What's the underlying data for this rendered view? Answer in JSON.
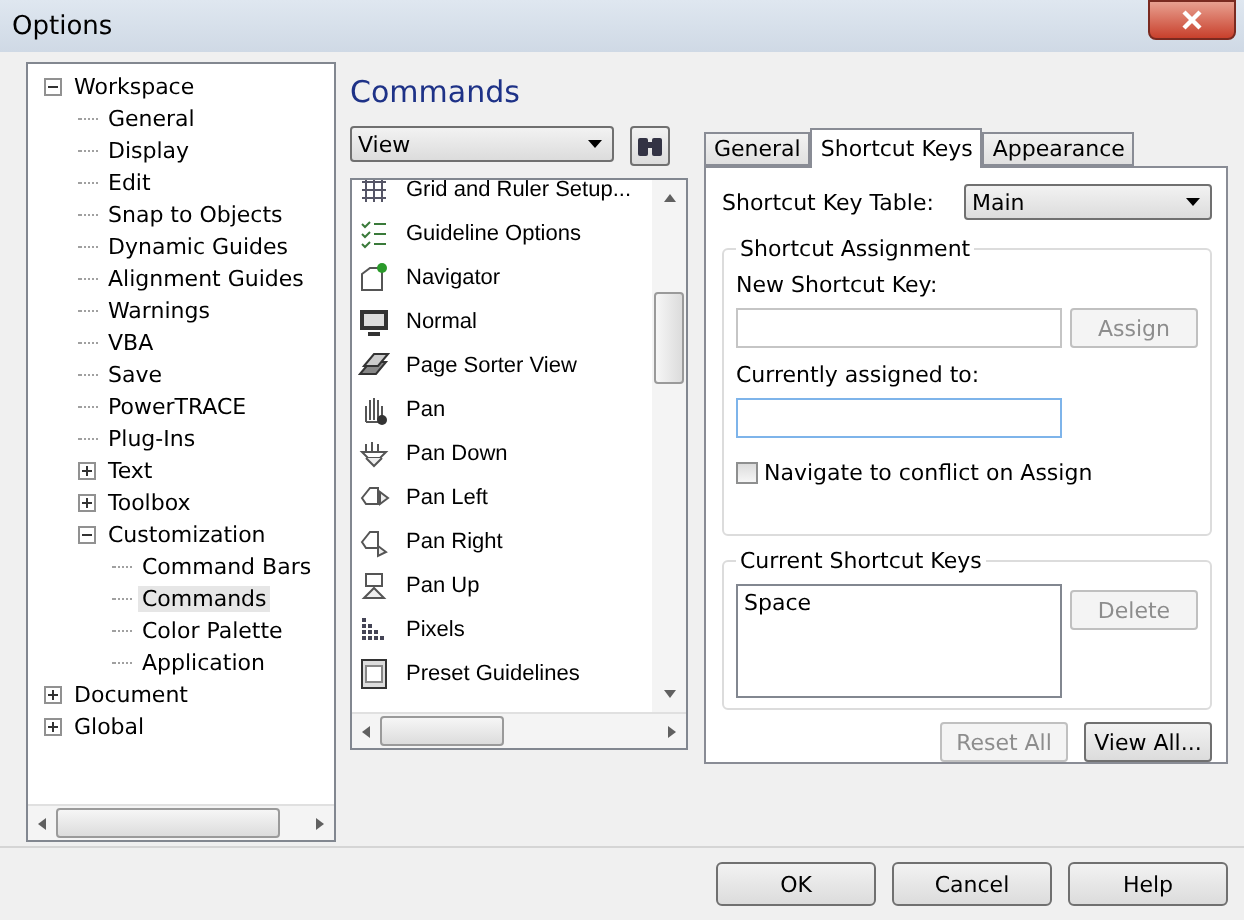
{
  "window": {
    "title": "Options"
  },
  "tree": [
    {
      "label": "Workspace",
      "expanded": true,
      "selected": false,
      "children": [
        {
          "label": "General",
          "selected": false
        },
        {
          "label": "Display",
          "selected": false
        },
        {
          "label": "Edit",
          "selected": false
        },
        {
          "label": "Snap to Objects",
          "selected": false
        },
        {
          "label": "Dynamic Guides",
          "selected": false
        },
        {
          "label": "Alignment Guides",
          "selected": false
        },
        {
          "label": "Warnings",
          "selected": false
        },
        {
          "label": "VBA",
          "selected": false
        },
        {
          "label": "Save",
          "selected": false
        },
        {
          "label": "PowerTRACE",
          "selected": false
        },
        {
          "label": "Plug-Ins",
          "selected": false
        },
        {
          "label": "Text",
          "expanded": false,
          "selected": false
        },
        {
          "label": "Toolbox",
          "expanded": false,
          "selected": false
        },
        {
          "label": "Customization",
          "expanded": true,
          "selected": false,
          "children": [
            {
              "label": "Command Bars",
              "selected": false
            },
            {
              "label": "Commands",
              "selected": true
            },
            {
              "label": "Color Palette",
              "selected": false
            },
            {
              "label": "Application",
              "selected": false
            }
          ]
        }
      ]
    },
    {
      "label": "Document",
      "expanded": false,
      "selected": false
    },
    {
      "label": "Global",
      "expanded": false,
      "selected": false
    }
  ],
  "heading": "Commands",
  "category": {
    "value": "View"
  },
  "commands": [
    "Grid and Ruler Setup...",
    "Guideline Options",
    "Navigator",
    "Normal",
    "Page Sorter View",
    "Pan",
    "Pan Down",
    "Pan Left",
    "Pan Right",
    "Pan Up",
    "Pixels",
    "Preset Guidelines"
  ],
  "tabs": [
    {
      "label": "General",
      "selected": false
    },
    {
      "label": "Shortcut Keys",
      "selected": true
    },
    {
      "label": "Appearance",
      "selected": false
    }
  ],
  "shortcut_table": {
    "label": "Shortcut Key Table:",
    "value": "Main"
  },
  "assignment": {
    "title": "Shortcut Assignment",
    "new_key_label": "New Shortcut Key:",
    "assign": {
      "label": "Assign",
      "disabled": true
    },
    "assigned_label": "Currently assigned to:",
    "navigate": {
      "label": "Navigate to conflict on Assign",
      "checked": false
    }
  },
  "current": {
    "title": "Current Shortcut Keys",
    "keys": [
      "Space"
    ],
    "delete": {
      "label": "Delete",
      "disabled": true
    }
  },
  "reset_all": {
    "label": "Reset All",
    "disabled": true
  },
  "view_all": {
    "label": "View All...",
    "disabled": false
  },
  "buttons": [
    "OK",
    "Cancel",
    "Help"
  ]
}
